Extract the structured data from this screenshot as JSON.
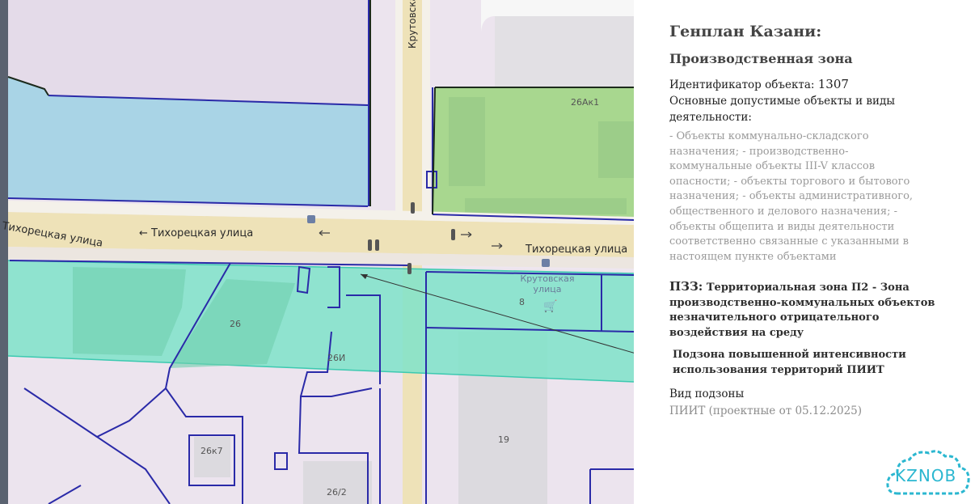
{
  "map": {
    "streets": {
      "tikhoretskaya_left_cut": "Тихорецкая улица",
      "tikhoretskaya_mid": "← Тихорецкая улица",
      "tikhoretskaya_right": "Тихорецкая улица",
      "krutovskaya_top": "Крутовская",
      "krutovskaya_bottom": "Крутовская улица"
    },
    "buildings": {
      "b26ak1": "26Ак1",
      "b26": "26",
      "b26i": "26И",
      "b26k7": "26к7",
      "b26_2": "26/2",
      "b8": "8",
      "b19": "19"
    },
    "colors": {
      "zone_fill": "#7fe3c9",
      "green_zone": "#a8d78f",
      "blue_zone": "#a9d4e6",
      "boundary": "#2a2aa8",
      "road": "#eee2b8"
    }
  },
  "panel": {
    "title": "Генплан Казани:",
    "zone_name": "Производственная зона",
    "id_label": "Идентификатор объекта:",
    "id_value": "1307",
    "allowed_label_1": "Основные допустимые объекты и виды",
    "allowed_label_2": "деятельности:",
    "allowed_text": "- Объекты коммунально-складского назначения; - производственно-коммунальные объекты III-V классов опасности; - объекты торгового и бытового назначения; - объекты административного, общественного и делового назначения; - объекты общепита и виды деятельности соответственно связанные с указанными в настоящем пункте объектами",
    "pzz_label": "ПЗЗ:",
    "pzz_text": "Территориальная зона П2 - Зона производственно-коммунальных объектов незначительного отрицательного воздействия на среду",
    "subzone_text": "Подзона повышенной интенсивности использования территорий ПИИТ",
    "subzone_kind_label": "Вид подзоны",
    "subzone_kind_value": "ПИИТ (проектные от 05.12.2025)"
  },
  "logo": {
    "text": "KZNOB",
    "color": "#2bb7d0"
  }
}
